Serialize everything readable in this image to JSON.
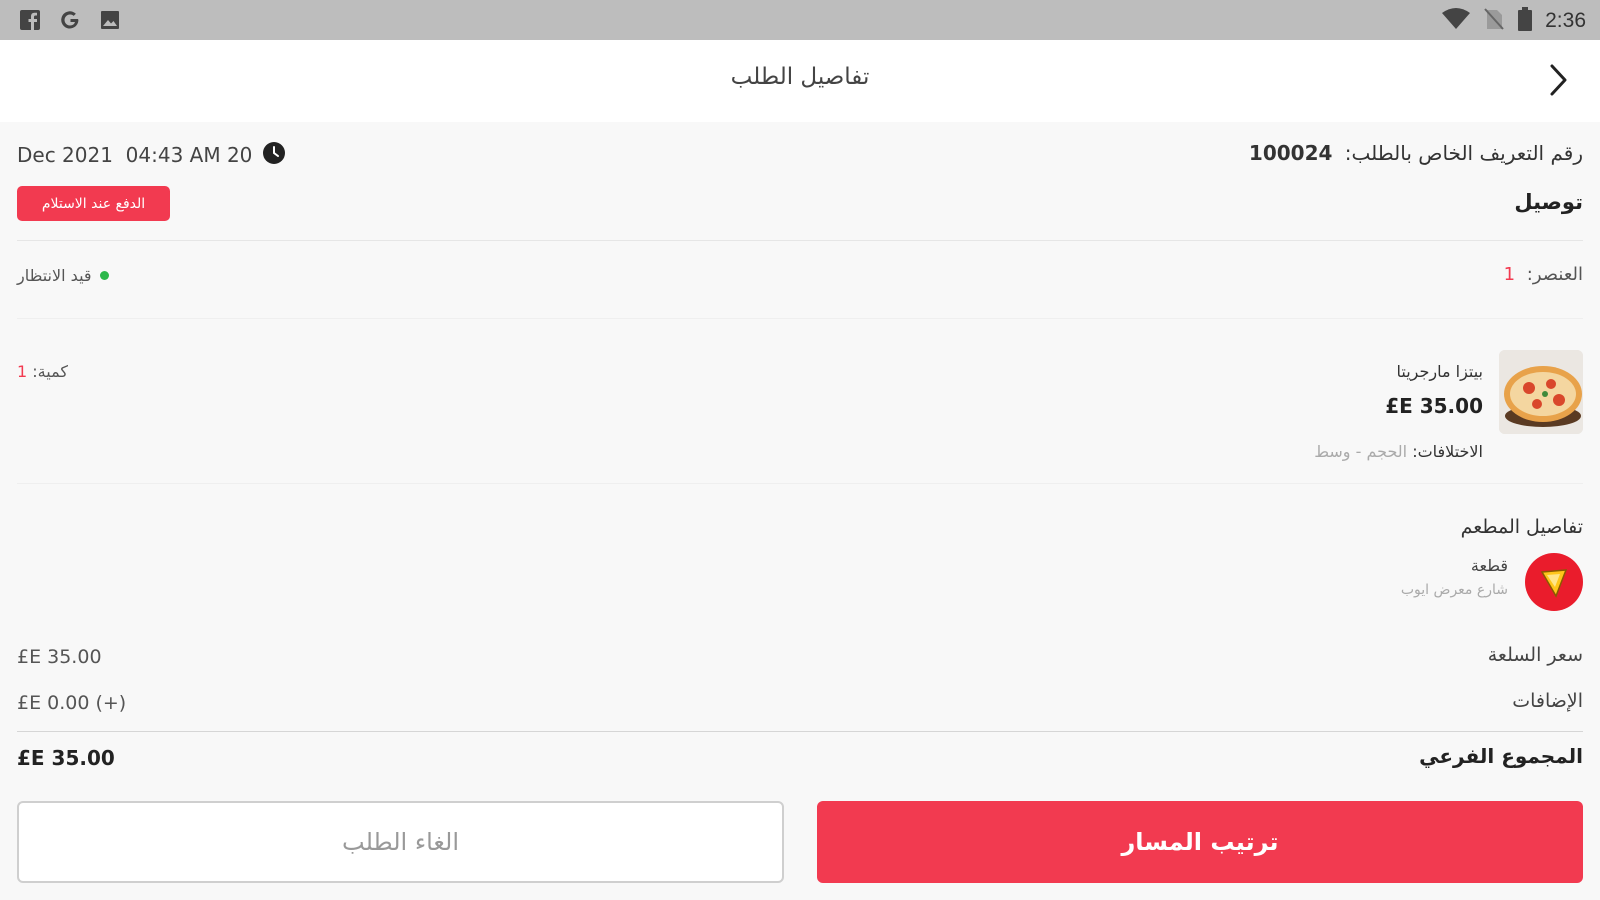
{
  "status_bar": {
    "time": "2:36",
    "left_icons": [
      "facebook-icon",
      "google-icon",
      "image-icon"
    ],
    "right_icons": [
      "wifi-icon",
      "no-sim-icon",
      "battery-icon"
    ]
  },
  "header": {
    "title": "تفاصيل الطلب",
    "back_icon": "chevron-right-icon"
  },
  "order": {
    "id_label": "رقم التعريف الخاص بالطلب:",
    "id_value": "100024",
    "datetime": "Dec 2021  04:43 AM 20",
    "type": "توصيل",
    "payment_badge": "الدفع عند الاستلام",
    "items_label": "العنصر:",
    "items_count": "1",
    "status": "قيد الانتظار"
  },
  "item": {
    "name": "بيتزا مارجريتا",
    "price": "£E 35.00",
    "variations_label": "الاختلافات:",
    "variations_value": "الحجم - وسط",
    "qty_label": "كمية:",
    "qty_value": "1"
  },
  "restaurant": {
    "section_title": "تفاصيل المطعم",
    "name": "قطعة",
    "address": "شارع معرض ايوب"
  },
  "summary": {
    "item_price_label": "سعر السلعة",
    "item_price_value": "£E 35.00",
    "addons_label": "الإضافات",
    "addons_value": "£E 0.00 (+)",
    "subtotal_label": "المجموع الفرعي",
    "subtotal_value": "£E 35.00"
  },
  "actions": {
    "cancel_label": "الغاء الطلب",
    "route_label": "ترتيب المسار"
  },
  "colors": {
    "accent": "#f23a50",
    "status_dot": "#2db84b",
    "status_bar": "#bdbdbd"
  }
}
